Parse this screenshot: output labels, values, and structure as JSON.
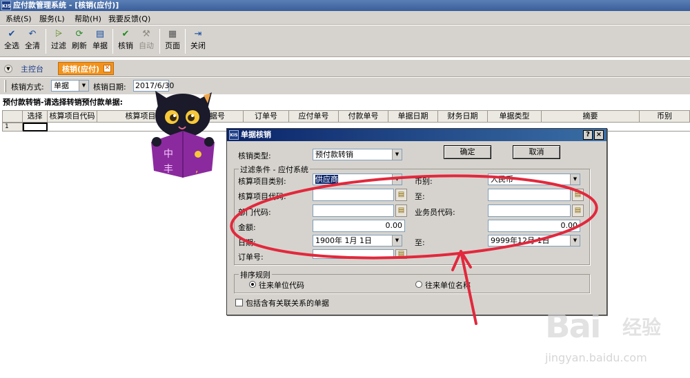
{
  "window": {
    "logo": "KIS",
    "title": "应付款管理系统 - [核销(应付)]"
  },
  "menu": [
    "系统(S)",
    "服务(L)",
    "帮助(H)",
    "我要反馈(Q)"
  ],
  "toolbar": [
    {
      "label": "全选",
      "icon": "✔",
      "icon_name": "select-all-icon"
    },
    {
      "label": "全清",
      "icon": "↶",
      "icon_name": "clear-all-icon"
    },
    {
      "label": "过滤",
      "icon": "⩥",
      "icon_name": "filter-icon"
    },
    {
      "label": "刷新",
      "icon": "⟳",
      "icon_name": "refresh-icon"
    },
    {
      "label": "单据",
      "icon": "▤",
      "icon_name": "document-icon"
    },
    {
      "label": "核销",
      "icon": "✔",
      "icon_name": "verify-icon"
    },
    {
      "label": "自动",
      "icon": "⚒",
      "icon_name": "auto-icon"
    },
    {
      "label": "页面",
      "icon": "▦",
      "icon_name": "page-icon"
    },
    {
      "label": "关闭",
      "icon": "⇥",
      "icon_name": "close-icon"
    }
  ],
  "tabs": {
    "home": "主控台",
    "active": "核销(应付)"
  },
  "filter": {
    "method_label": "核销方式:",
    "method_value": "单据",
    "date_label": "核销日期:",
    "date_value": "2017/6/30"
  },
  "caption": "预付款转销-请选择转销预付款单据:",
  "grid": {
    "columns": [
      "选择",
      "核算项目代码",
      "核算项目",
      "单据号",
      "订单号",
      "应付单号",
      "付款单号",
      "单据日期",
      "财务日期",
      "单据类型",
      "摘要",
      "币别"
    ],
    "row_number": "1"
  },
  "dialog": {
    "logo": "KIS",
    "title": "单据核销",
    "help": "?",
    "close": "×",
    "type_label": "核销类型:",
    "type_value": "预付款转销",
    "ok": "确定",
    "cancel": "取消",
    "group_title": "过滤条件 - 应付系统",
    "item_category_label": "核算项目类别:",
    "item_category_value": "供应商",
    "currency_label": "币别:",
    "currency_value": "人民币",
    "item_code_label": "核算项目代码:",
    "to1": "至:",
    "dept_label": "部门代码:",
    "salesman_label": "业务员代码:",
    "amount_label": "金额:",
    "amount_from": "0.00",
    "amount_to": "0.00",
    "date_label": "日期:",
    "date_from": "1900年 1月 1日",
    "to2": "至:",
    "date_to": "9999年12月 1日",
    "order_label": "订单号:",
    "sort_title": "排序规则",
    "sort_opt1": "往来单位代码",
    "sort_opt2": "往来单位名称",
    "include_related": "包括含有关联关系的单据"
  },
  "mascot": {
    "chars": [
      "中",
      "丰"
    ]
  },
  "watermark": {
    "brand": "Bai",
    "brand_tail": "经验",
    "url": "jingyan.baidu.com"
  },
  "colors": {
    "accent": "#f2931d",
    "title": "#0a246a",
    "annotation": "#e2283c",
    "mascot": "#8b2a9e"
  }
}
